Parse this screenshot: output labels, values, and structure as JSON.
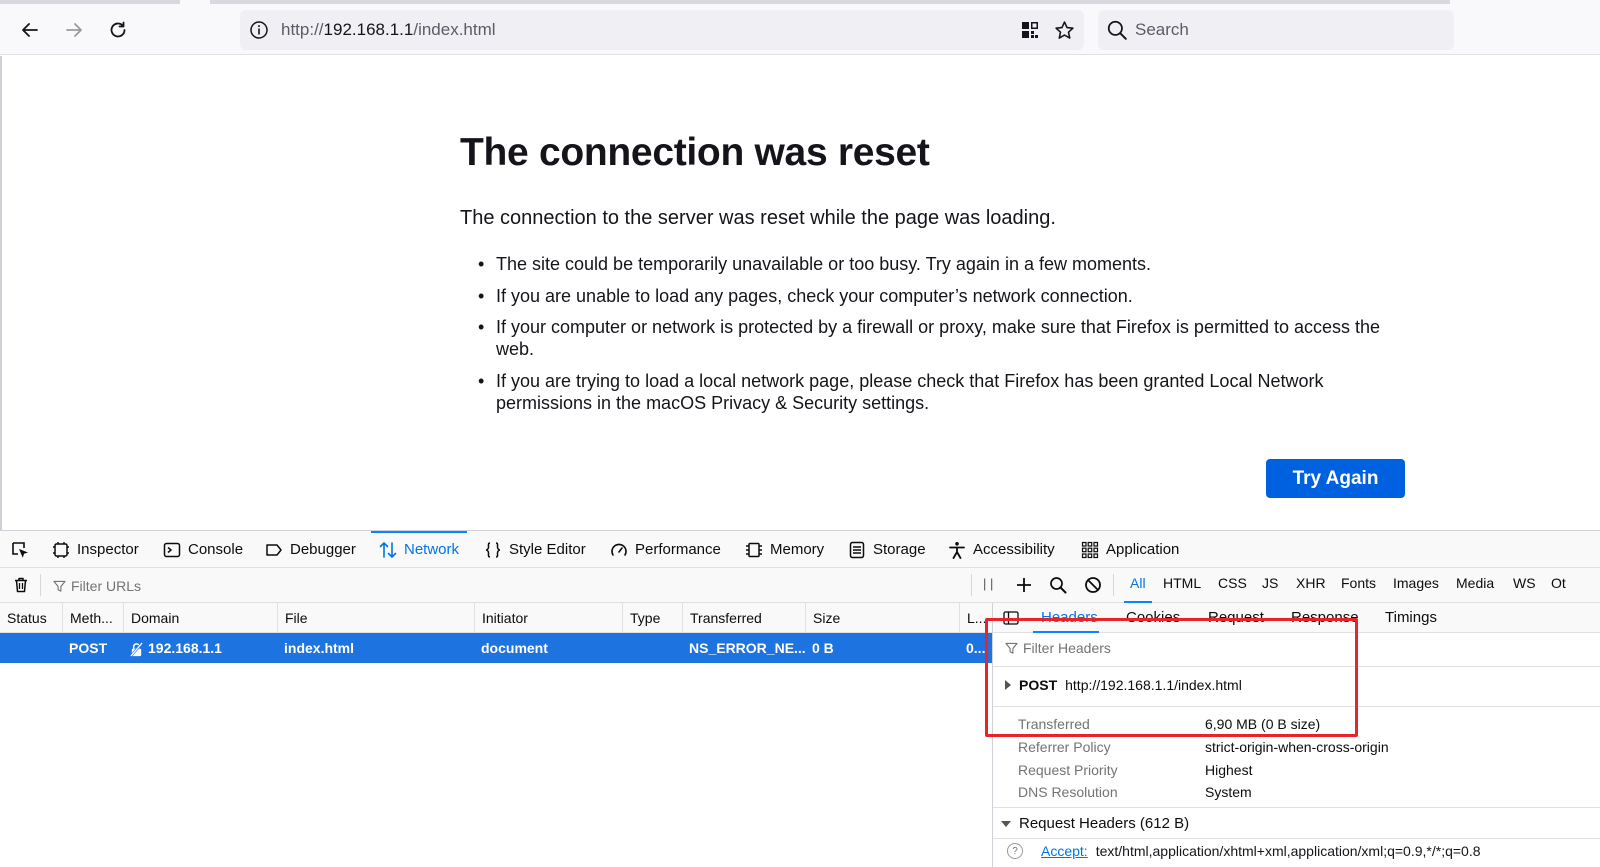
{
  "browser": {
    "url_prefix": "http://",
    "url_host": "192.168.1.1",
    "url_path": "/index.html",
    "search_placeholder": "Search"
  },
  "error_page": {
    "title": "The connection was reset",
    "description": "The connection to the server was reset while the page was loading.",
    "items": [
      "The site could be temporarily unavailable or too busy. Try again in a few moments.",
      "If you are unable to load any pages, check your computer’s network connection.",
      "If your computer or network is protected by a firewall or proxy, make sure that Firefox is permitted to access the web.",
      "If you are trying to load a local network page, please check that Firefox has been granted Local Network permissions in the macOS Privacy & Security settings."
    ],
    "try_again_label": "Try Again",
    "accent_color": "#0061e0"
  },
  "devtools": {
    "tabs": [
      {
        "label": "Inspector",
        "icon": "inspector-icon"
      },
      {
        "label": "Console",
        "icon": "console-icon"
      },
      {
        "label": "Debugger",
        "icon": "debugger-icon"
      },
      {
        "label": "Network",
        "icon": "network-icon",
        "active": true
      },
      {
        "label": "Style Editor",
        "icon": "style-editor-icon"
      },
      {
        "label": "Performance",
        "icon": "performance-icon"
      },
      {
        "label": "Memory",
        "icon": "memory-icon"
      },
      {
        "label": "Storage",
        "icon": "storage-icon"
      },
      {
        "label": "Accessibility",
        "icon": "accessibility-icon"
      },
      {
        "label": "Application",
        "icon": "application-icon"
      }
    ],
    "filter_urls_placeholder": "Filter URLs",
    "pause_label": "| |",
    "type_filters": [
      "All",
      "HTML",
      "CSS",
      "JS",
      "XHR",
      "Fonts",
      "Images",
      "Media",
      "WS",
      "Ot"
    ],
    "columns": [
      "Status",
      "Meth...",
      "Domain",
      "File",
      "Initiator",
      "Type",
      "Transferred",
      "Size",
      "L..."
    ],
    "request": {
      "status": "",
      "method": "POST",
      "domain": "192.168.1.1",
      "file": "index.html",
      "initiator": "document",
      "type": "",
      "transferred": "NS_ERROR_NE...",
      "size": "0 B",
      "last": "0..."
    },
    "side_panel": {
      "tabs": [
        "Headers",
        "Cookies",
        "Request",
        "Response",
        "Timings"
      ],
      "filter_headers_placeholder": "Filter Headers",
      "summary_method": "POST",
      "summary_url": "http://192.168.1.1/index.html",
      "details": [
        {
          "key": "Transferred",
          "value": "6,90 MB (0 B size)"
        },
        {
          "key": "Referrer Policy",
          "value": "strict-origin-when-cross-origin"
        },
        {
          "key": "Request Priority",
          "value": "Highest"
        },
        {
          "key": "DNS Resolution",
          "value": "System"
        }
      ],
      "request_headers_title": "Request Headers (612 B)",
      "accept_key": "Accept:",
      "accept_value": "text/html,application/xhtml+xml,application/xml;q=0.9,*/*;q=0.8",
      "help_glyph": "?"
    },
    "selected_row_color": "#1d74e1",
    "annotation_color": "#e8242b"
  }
}
